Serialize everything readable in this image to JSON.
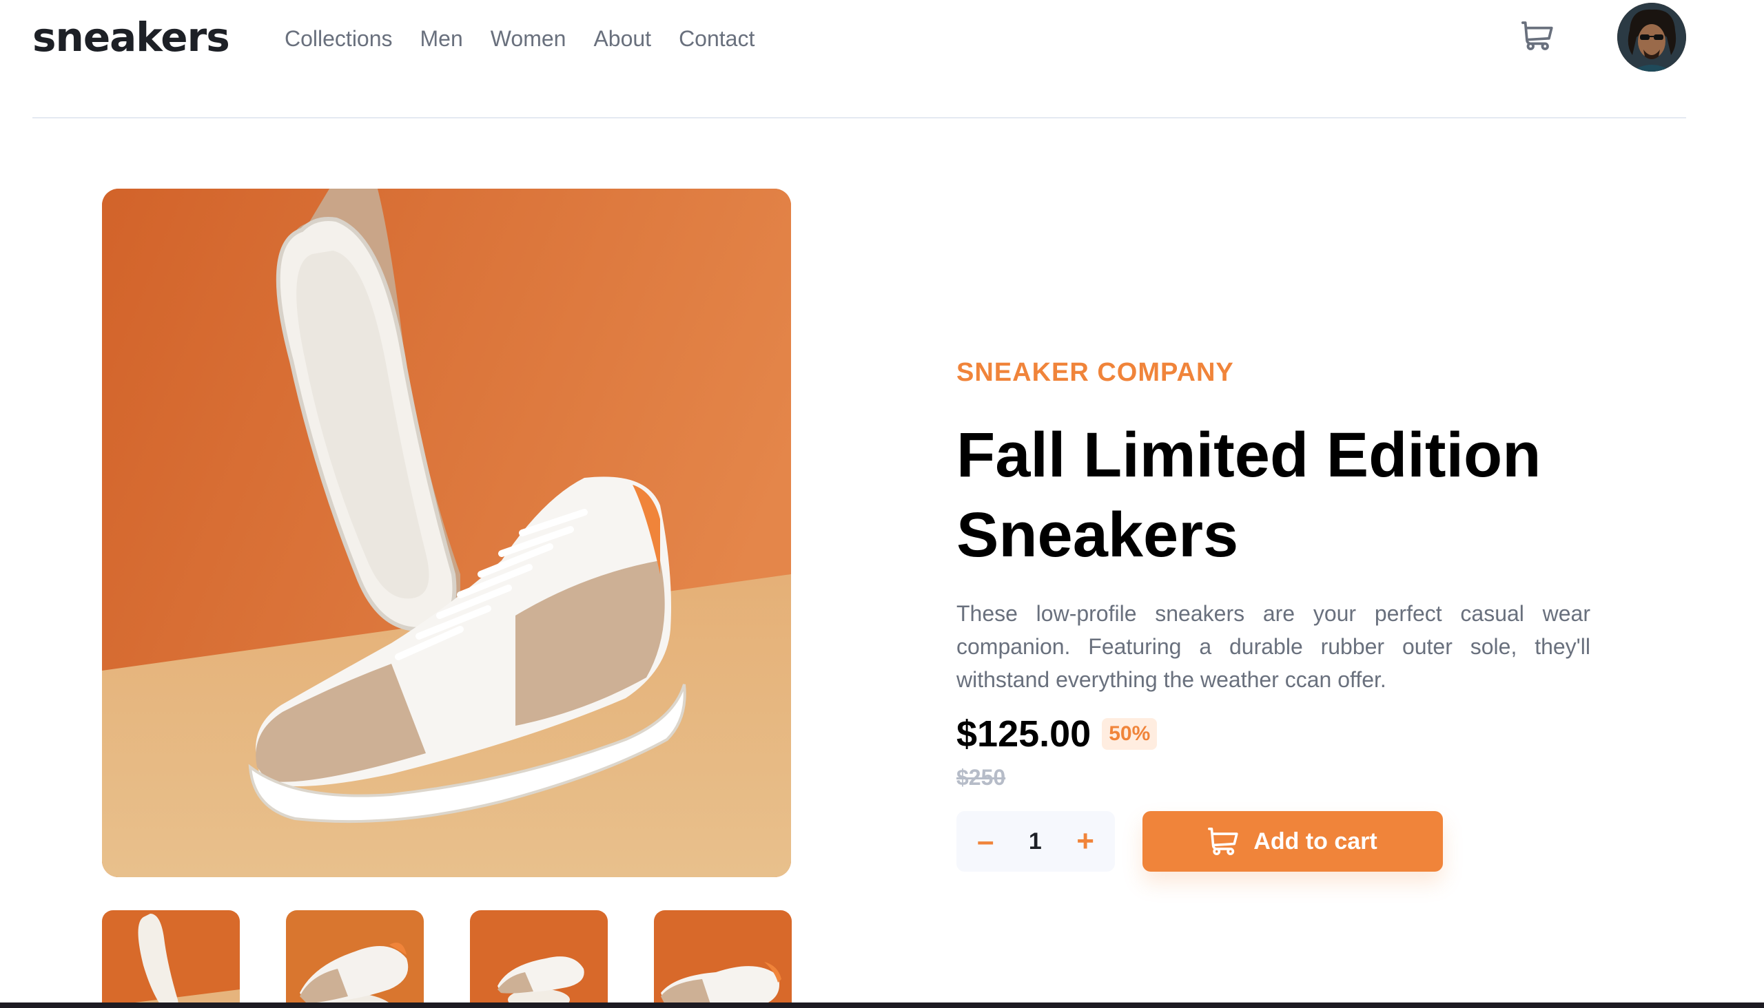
{
  "header": {
    "logo": "sneakers",
    "nav": [
      "Collections",
      "Men",
      "Women",
      "About",
      "Contact"
    ]
  },
  "product": {
    "company": "SNEAKER COMPANY",
    "title": "Fall Limited Edition Sneakers",
    "description": "These low-profile sneakers are your perfect casual wear companion. Featuring a durable rubber outer sole, they'll withstand everything the weather ccan offer.",
    "price": "$125.00",
    "discount": "50%",
    "old_price": "$250",
    "quantity": "1",
    "decrement_label": "–",
    "increment_label": "+",
    "add_to_cart_label": "Add to cart"
  },
  "colors": {
    "accent": "#f0843a",
    "accent_light": "#ffede0",
    "text_dark": "#1d2026",
    "text_muted": "#69707d"
  },
  "icons": {
    "cart": "cart-icon",
    "avatar": "user-avatar"
  }
}
